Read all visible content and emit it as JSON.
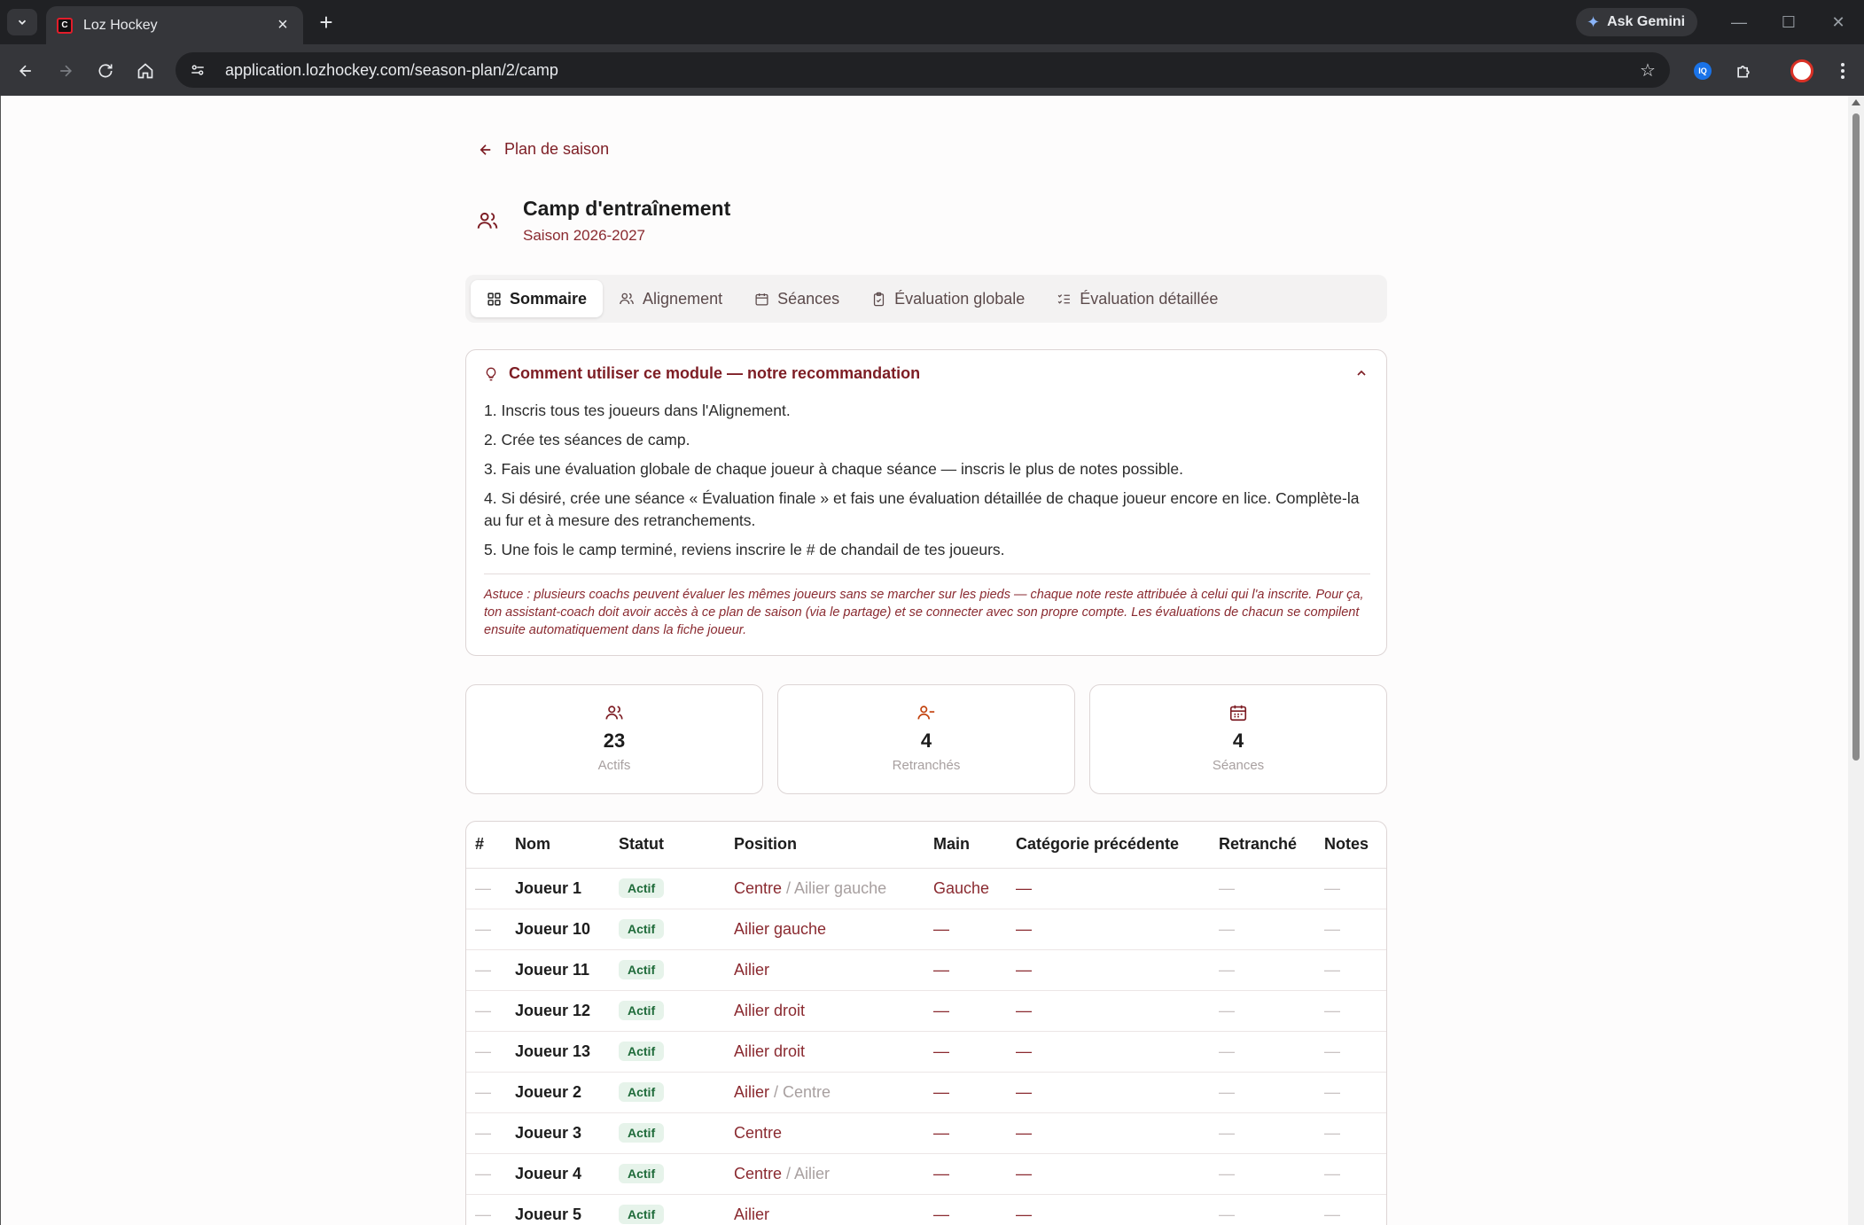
{
  "browser": {
    "tab_title": "Loz Hockey",
    "favicon_text": "C",
    "url": "application.lozhockey.com/season-plan/2/camp",
    "gemini_label": "Ask Gemini",
    "ext_label": "IQ"
  },
  "page": {
    "back_label": "Plan de saison",
    "title": "Camp d'entraînement",
    "subtitle": "Saison 2026-2027",
    "tabs": [
      {
        "label": "Sommaire",
        "icon": "grid-icon",
        "active": true
      },
      {
        "label": "Alignement",
        "icon": "users-icon",
        "active": false
      },
      {
        "label": "Séances",
        "icon": "calendar-icon",
        "active": false
      },
      {
        "label": "Évaluation globale",
        "icon": "clipboard-check-icon",
        "active": false
      },
      {
        "label": "Évaluation détaillée",
        "icon": "list-checks-icon",
        "active": false
      }
    ]
  },
  "recommendation": {
    "title": "Comment utiliser ce module — notre recommandation",
    "steps": [
      "1. Inscris tous tes joueurs dans l'Alignement.",
      "2. Crée tes séances de camp.",
      "3. Fais une évaluation globale de chaque joueur à chaque séance — inscris le plus de notes possible.",
      "4. Si désiré, crée une séance « Évaluation finale » et fais une évaluation détaillée de chaque joueur encore en lice. Complète-la au fur et à mesure des retranchements.",
      "5. Une fois le camp terminé, reviens inscrire le # de chandail de tes joueurs."
    ],
    "tip": "Astuce : plusieurs coachs peuvent évaluer les mêmes joueurs sans se marcher sur les pieds — chaque note reste attribuée à celui qui l'a inscrite. Pour ça, ton assistant-coach doit avoir accès à ce plan de saison (via le partage) et se connecter avec son propre compte. Les évaluations de chacun se compilent ensuite automatiquement dans la fiche joueur."
  },
  "stats": [
    {
      "value": "23",
      "label": "Actifs",
      "icon": "users-icon",
      "color": "#7d1d24"
    },
    {
      "value": "4",
      "label": "Retranchés",
      "icon": "user-minus-icon",
      "color": "#c2410c"
    },
    {
      "value": "4",
      "label": "Séances",
      "icon": "calendar-icon",
      "color": "#7d1d24"
    }
  ],
  "table": {
    "headers": [
      "#",
      "Nom",
      "Statut",
      "Position",
      "Main",
      "Catégorie précédente",
      "Retranché",
      "Notes"
    ],
    "rows": [
      {
        "num": "—",
        "nom": "Joueur 1",
        "statut": "Actif",
        "pos": "Centre",
        "pos2": "Ailier gauche",
        "main": "Gauche",
        "cat": "—",
        "ret": "—",
        "notes": "—"
      },
      {
        "num": "—",
        "nom": "Joueur 10",
        "statut": "Actif",
        "pos": "Ailier gauche",
        "pos2": "",
        "main": "—",
        "cat": "—",
        "ret": "—",
        "notes": "—"
      },
      {
        "num": "—",
        "nom": "Joueur 11",
        "statut": "Actif",
        "pos": "Ailier",
        "pos2": "",
        "main": "—",
        "cat": "—",
        "ret": "—",
        "notes": "—"
      },
      {
        "num": "—",
        "nom": "Joueur 12",
        "statut": "Actif",
        "pos": "Ailier droit",
        "pos2": "",
        "main": "—",
        "cat": "—",
        "ret": "—",
        "notes": "—"
      },
      {
        "num": "—",
        "nom": "Joueur 13",
        "statut": "Actif",
        "pos": "Ailier droit",
        "pos2": "",
        "main": "—",
        "cat": "—",
        "ret": "—",
        "notes": "—"
      },
      {
        "num": "—",
        "nom": "Joueur 2",
        "statut": "Actif",
        "pos": "Ailier",
        "pos2": "Centre",
        "main": "—",
        "cat": "—",
        "ret": "—",
        "notes": "—"
      },
      {
        "num": "—",
        "nom": "Joueur 3",
        "statut": "Actif",
        "pos": "Centre",
        "pos2": "",
        "main": "—",
        "cat": "—",
        "ret": "—",
        "notes": "—"
      },
      {
        "num": "—",
        "nom": "Joueur 4",
        "statut": "Actif",
        "pos": "Centre",
        "pos2": "Ailier",
        "main": "—",
        "cat": "—",
        "ret": "—",
        "notes": "—"
      },
      {
        "num": "—",
        "nom": "Joueur 5",
        "statut": "Actif",
        "pos": "Ailier",
        "pos2": "",
        "main": "—",
        "cat": "—",
        "ret": "—",
        "notes": "—"
      }
    ]
  }
}
